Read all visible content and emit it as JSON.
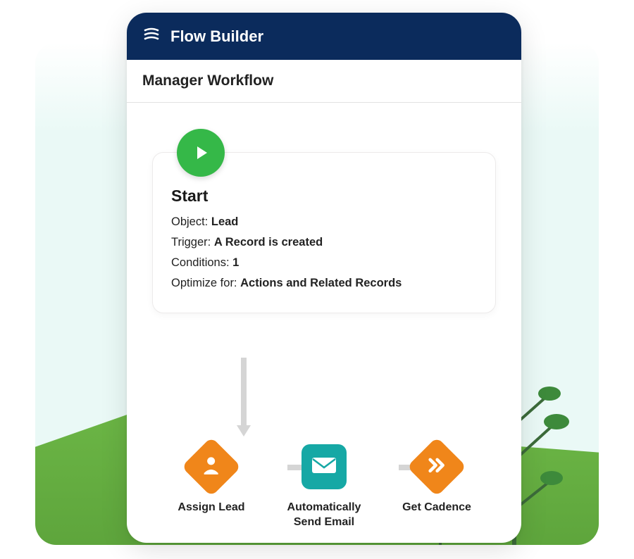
{
  "app": {
    "title": "Flow Builder"
  },
  "workflow": {
    "name": "Manager Workflow"
  },
  "colors": {
    "header_bg": "#0b2b5c",
    "green": "#35b848",
    "orange": "#f0861a",
    "teal": "#16a8a5"
  },
  "start": {
    "title": "Start",
    "rows": [
      {
        "label": "Object:",
        "value": "Lead"
      },
      {
        "label": "Trigger:",
        "value": "A Record is created"
      },
      {
        "label": "Conditions:",
        "value": "1"
      },
      {
        "label": "Optimize for:",
        "value": "Actions and Related Records"
      }
    ]
  },
  "nodes": [
    {
      "icon": "person-star-icon",
      "shape": "diamond",
      "label": "Assign Lead"
    },
    {
      "icon": "envelope-icon",
      "shape": "square",
      "label": "Automatically Send Email"
    },
    {
      "icon": "double-chevron-icon",
      "shape": "diamond",
      "label": "Get Cadence"
    }
  ]
}
